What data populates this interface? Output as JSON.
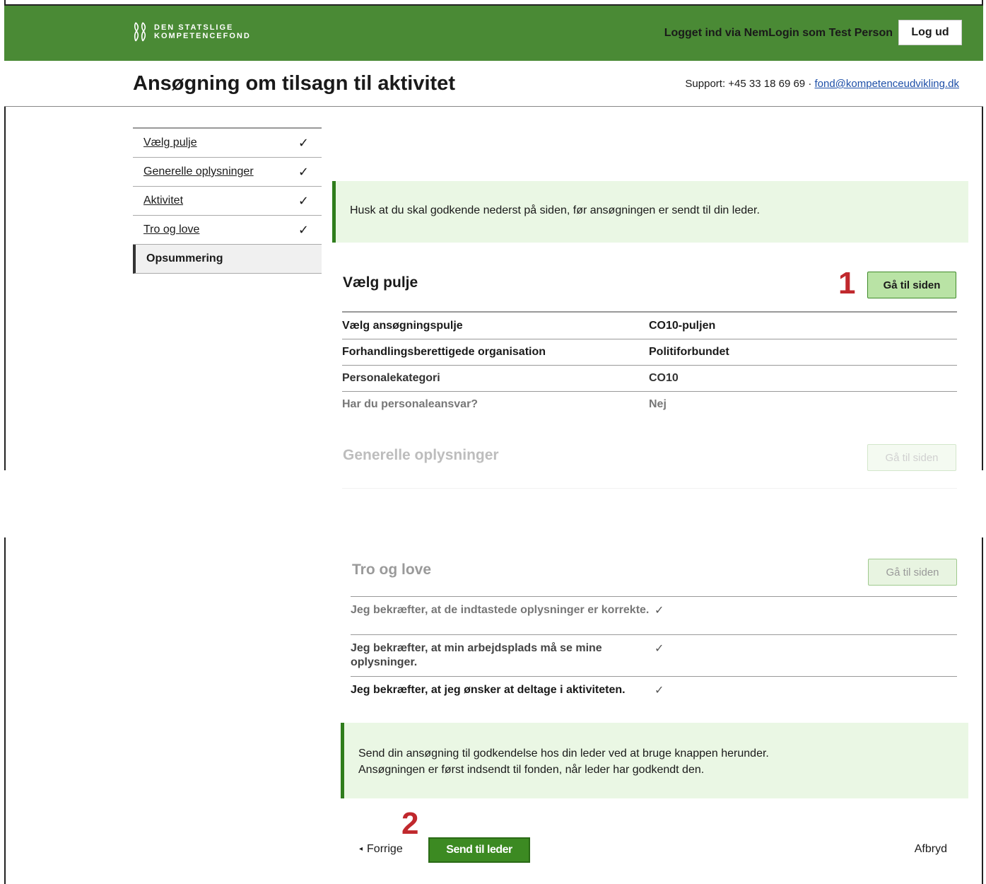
{
  "topbar": {
    "logo_line1": "DEN STATSLIGE",
    "logo_line2": "KOMPETENCEFOND",
    "login_text": "Logget ind via NemLogin som Test Person",
    "logout_label": "Log ud",
    "color": "#4a8a35"
  },
  "header": {
    "title": "Ansøgning om tilsagn til aktivitet",
    "support_prefix": "Support: +45 33 18 69 69 · ",
    "support_email": "fond@kompetenceudvikling.dk"
  },
  "sidebar": {
    "items": [
      {
        "label": "Vælg pulje",
        "check": "✓"
      },
      {
        "label": "Generelle oplysninger",
        "check": "✓"
      },
      {
        "label": "Aktivitet",
        "check": "✓"
      },
      {
        "label": "Tro og love",
        "check": "✓"
      },
      {
        "label": "Opsummering",
        "check": ""
      }
    ]
  },
  "alerts": {
    "top": "Husk at du skal godkende nederst på siden, før ansøgningen er sendt til din leder.",
    "bottom_line1": "Send din ansøgning til godkendelse hos din leder ved at bruge knappen herunder.",
    "bottom_line2": "Ansøgningen er først indsendt til fonden, når leder har godkendt den."
  },
  "sections": {
    "pulje": {
      "title": "Vælg pulje",
      "button": "Gå til siden",
      "rows": [
        {
          "k": "Vælg ansøgningspulje",
          "v": "CO10-puljen"
        },
        {
          "k": "Forhandlingsberettigede organisation",
          "v": "Politiforbundet"
        },
        {
          "k": "Personalekategori",
          "v": "CO10"
        },
        {
          "k": "Har du personaleansvar?",
          "v": "Nej"
        }
      ]
    },
    "generelle": {
      "title": "Generelle oplysninger",
      "button": "Gå til siden"
    },
    "tro": {
      "title": "Tro og love",
      "button": "Gå til siden",
      "rows": [
        {
          "k": "Jeg bekræfter, at de indtastede oplysninger er korrekte.",
          "v": "✓"
        },
        {
          "k": "Jeg bekræfter, at min arbejdsplads må se mine oplysninger.",
          "v": "✓"
        },
        {
          "k": "Jeg bekræfter, at jeg ønsker at deltage i aktiviteten.",
          "v": "✓"
        }
      ]
    }
  },
  "markers": {
    "one": "1",
    "two": "2"
  },
  "footer": {
    "prev_icon": "◂",
    "prev_label": "Forrige",
    "send_label": "Send til leder",
    "cancel_label": "Afbryd"
  }
}
